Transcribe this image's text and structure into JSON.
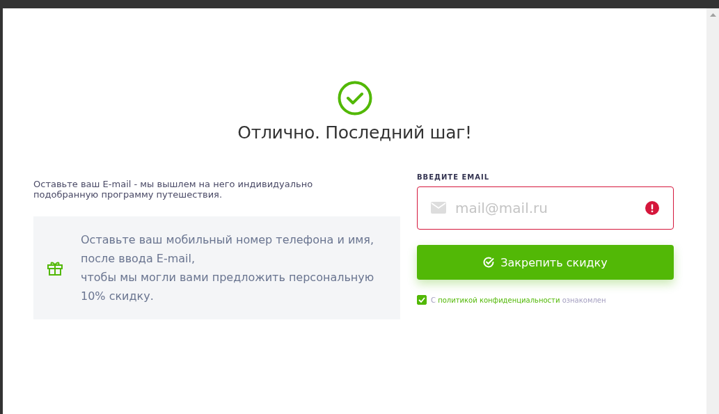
{
  "success": {
    "title": "Отлично. Последний шаг!"
  },
  "intro": "Оставьте ваш E-mail - мы вышлем на него индивидуально подобранную программу путешествия.",
  "offer": {
    "lines": [
      "Оставьте ваш мобильный номер телефона и имя,",
      "после ввода E-mail,",
      "чтобы мы могли вами предложить персональную",
      "10% скидку."
    ]
  },
  "email_field": {
    "label": "ВВЕДИТЕ EMAIL",
    "placeholder": "mail@mail.ru",
    "error": true
  },
  "submit_button": {
    "label": "Закрепить скидку"
  },
  "consent": {
    "checked": true,
    "prefix": "С",
    "link": "политикой конфиденциальности",
    "suffix": "ознакомлен"
  }
}
